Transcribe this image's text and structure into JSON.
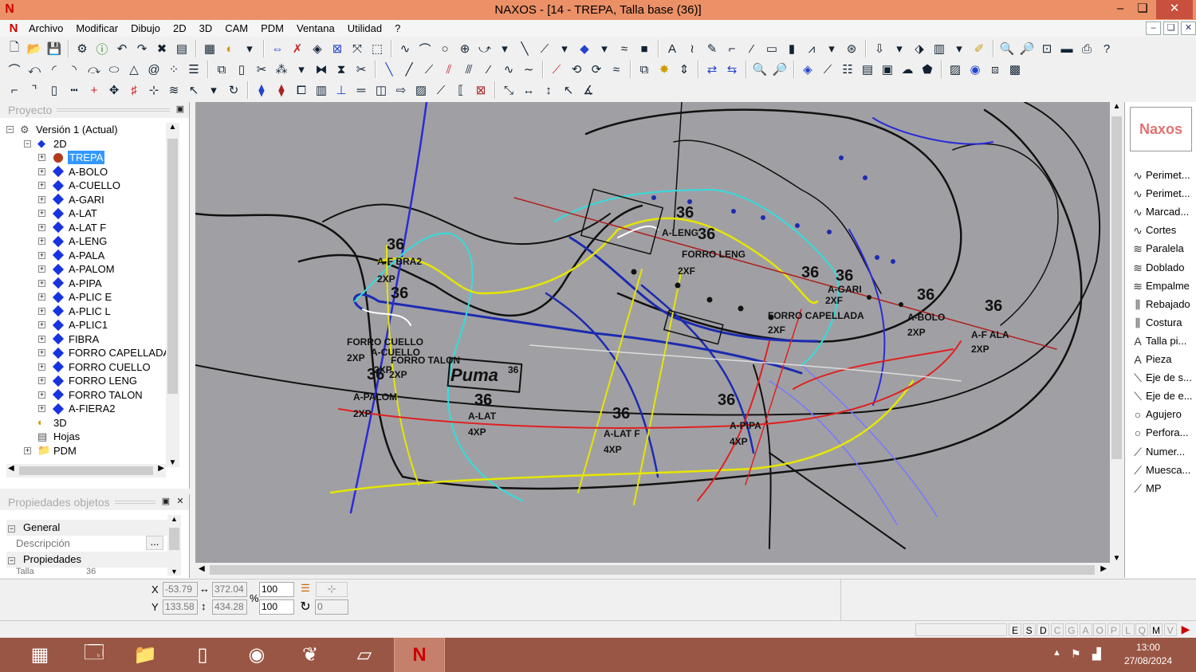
{
  "window": {
    "title": "NAXOS - [14 - TREPA, Talla base (36)]",
    "logo": "N",
    "min": "–",
    "max": "❏",
    "close": "✕"
  },
  "menu": {
    "items": [
      "Archivo",
      "Modificar",
      "Dibujo",
      "2D",
      "3D",
      "CAM",
      "PDM",
      "Ventana",
      "Utilidad",
      "?"
    ]
  },
  "project_panel": {
    "title": "Proyecto",
    "tree": [
      {
        "label": "Versión 1 (Actual)",
        "level": 0,
        "icon": "version-icon"
      },
      {
        "label": "2D",
        "level": 1,
        "icon": "2d-icon"
      },
      {
        "label": "TREPA",
        "level": 2,
        "icon": "piece-red-dot-icon",
        "selected": true
      },
      {
        "label": "A-BOLO",
        "level": 2
      },
      {
        "label": "A-CUELLO",
        "level": 2
      },
      {
        "label": "A-GARI",
        "level": 2
      },
      {
        "label": "A-LAT",
        "level": 2
      },
      {
        "label": "A-LAT F",
        "level": 2
      },
      {
        "label": "A-LENG",
        "level": 2
      },
      {
        "label": "A-PALA",
        "level": 2
      },
      {
        "label": "A-PALOM",
        "level": 2
      },
      {
        "label": "A-PIPA",
        "level": 2
      },
      {
        "label": "A-PLIC E",
        "level": 2
      },
      {
        "label": "A-PLIC L",
        "level": 2
      },
      {
        "label": "A-PLIC1",
        "level": 2
      },
      {
        "label": "FIBRA",
        "level": 2
      },
      {
        "label": "FORRO CAPELLADA",
        "level": 2
      },
      {
        "label": "FORRO CUELLO",
        "level": 2
      },
      {
        "label": "FORRO LENG",
        "level": 2
      },
      {
        "label": "FORRO TALON",
        "level": 2
      },
      {
        "label": "A-FIERA2",
        "level": 2
      },
      {
        "label": "3D",
        "level": 1,
        "icon": "3d-icon"
      },
      {
        "label": "Hojas",
        "level": 1,
        "icon": "sheets-icon"
      },
      {
        "label": "PDM",
        "level": 1,
        "icon": "folder-icon"
      }
    ]
  },
  "properties_panel": {
    "title": "Propiedades objetos",
    "general": "General",
    "descripcion": "Descripción",
    "descripcion_btn": "...",
    "propiedades": "Propiedades",
    "talla_label": "Talla",
    "talla_value": "36"
  },
  "canvas": {
    "labels": [
      {
        "t": "36",
        "cls": "big"
      },
      {
        "t": "A-LENG"
      },
      {
        "t": "36",
        "cls": "big"
      },
      {
        "t": "FORRO LENG"
      },
      {
        "t": "2XF"
      },
      {
        "t": "36",
        "cls": "big"
      },
      {
        "t": "A-F BRA2"
      },
      {
        "t": "2XP"
      },
      {
        "t": "36",
        "cls": "big"
      },
      {
        "t": "FORRO CUELLO"
      },
      {
        "t": "2XP"
      },
      {
        "t": "A-CUELLO"
      },
      {
        "t": "2XP"
      },
      {
        "t": "36",
        "cls": "big"
      },
      {
        "t": "2XP"
      },
      {
        "t": "FORRO TALON"
      },
      {
        "t": "36",
        "cls": "big"
      },
      {
        "t": "A-PALOM"
      },
      {
        "t": "2XP"
      },
      {
        "t": "36",
        "cls": "big"
      },
      {
        "t": "A-LAT"
      },
      {
        "t": "4XP"
      },
      {
        "t": "36",
        "cls": "big"
      },
      {
        "t": "A-LAT F"
      },
      {
        "t": "4XP"
      },
      {
        "t": "36",
        "cls": "big"
      },
      {
        "t": "A-PIPA"
      },
      {
        "t": "4XP"
      },
      {
        "t": "36",
        "cls": "big"
      },
      {
        "t": "36",
        "cls": "big"
      },
      {
        "t": "A-GARI"
      },
      {
        "t": "2XF"
      },
      {
        "t": "FORRO CAPELLADA"
      },
      {
        "t": "2XF"
      },
      {
        "t": "36",
        "cls": "big"
      },
      {
        "t": "A-BOLO"
      },
      {
        "t": "2XP"
      },
      {
        "t": "36",
        "cls": "big"
      },
      {
        "t": "A-F ALA"
      },
      {
        "t": "2XP"
      },
      {
        "t": "Puma"
      },
      {
        "t": "36"
      }
    ]
  },
  "palette": {
    "logo": "Naxos",
    "items": [
      {
        "label": "Perimet...",
        "icon": "perimeter-icon"
      },
      {
        "label": "Perimet...",
        "icon": "perimeter-icon"
      },
      {
        "label": "Marcad...",
        "icon": "marker-icon"
      },
      {
        "label": "Cortes",
        "icon": "cuts-icon"
      },
      {
        "label": "Paralela",
        "icon": "parallel-icon"
      },
      {
        "label": "Doblado",
        "icon": "fold-icon"
      },
      {
        "label": "Empalme",
        "icon": "join-icon"
      },
      {
        "label": "Rebajado",
        "icon": "skive-icon"
      },
      {
        "label": "Costura",
        "icon": "seam-icon"
      },
      {
        "label": "Talla pi...",
        "icon": "size-text-icon"
      },
      {
        "label": "Pieza",
        "icon": "piece-text-icon"
      },
      {
        "label": "Eje de s...",
        "icon": "axis-icon"
      },
      {
        "label": "Eje de e...",
        "icon": "axis-icon"
      },
      {
        "label": "Agujero",
        "icon": "hole-icon"
      },
      {
        "label": "Perfora...",
        "icon": "perforation-icon"
      },
      {
        "label": "Numer...",
        "icon": "numbering-icon"
      },
      {
        "label": "Muesca...",
        "icon": "notch-icon"
      },
      {
        "label": "MP",
        "icon": "mp-icon"
      }
    ]
  },
  "coords": {
    "x_label": "X",
    "y_label": "Y",
    "x": "-53.79",
    "y": "133.58",
    "w": "372.04",
    "h": "434.28",
    "sx": "100",
    "sy": "100",
    "pct": "%",
    "angle": "0"
  },
  "status": {
    "letters": [
      "E",
      "S",
      "D",
      "C",
      "G",
      "A",
      "O",
      "P",
      "L",
      "Q",
      "M",
      "V"
    ]
  },
  "taskbar": {
    "time": "13:00",
    "date": "27/08/2024"
  },
  "colors": {
    "title_bg": "#eb9067",
    "canvas_bg": "#a0a0a4",
    "taskbar_bg": "#9a5644",
    "selection": "#3399ff"
  }
}
